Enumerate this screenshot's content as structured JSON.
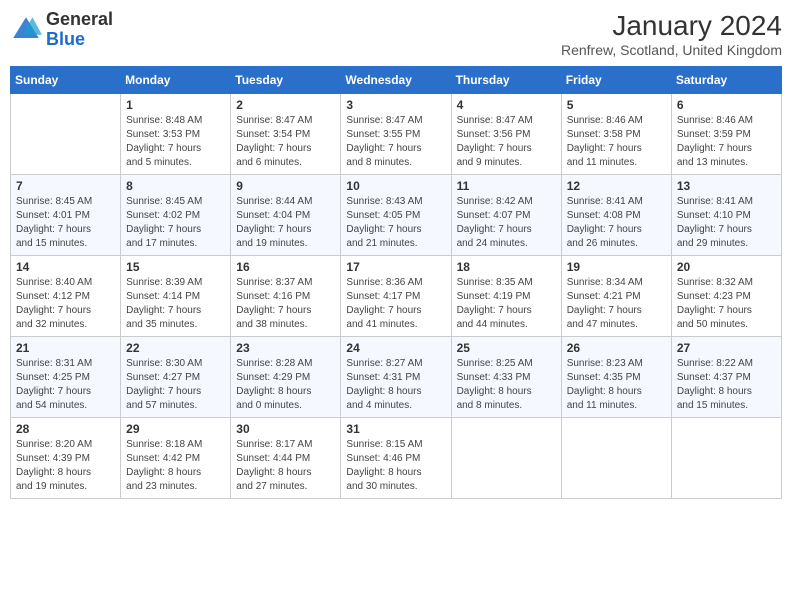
{
  "header": {
    "logo_line1": "General",
    "logo_line2": "Blue",
    "title": "January 2024",
    "location": "Renfrew, Scotland, United Kingdom"
  },
  "columns": [
    "Sunday",
    "Monday",
    "Tuesday",
    "Wednesday",
    "Thursday",
    "Friday",
    "Saturday"
  ],
  "weeks": [
    [
      {
        "day": "",
        "info": ""
      },
      {
        "day": "1",
        "info": "Sunrise: 8:48 AM\nSunset: 3:53 PM\nDaylight: 7 hours\nand 5 minutes."
      },
      {
        "day": "2",
        "info": "Sunrise: 8:47 AM\nSunset: 3:54 PM\nDaylight: 7 hours\nand 6 minutes."
      },
      {
        "day": "3",
        "info": "Sunrise: 8:47 AM\nSunset: 3:55 PM\nDaylight: 7 hours\nand 8 minutes."
      },
      {
        "day": "4",
        "info": "Sunrise: 8:47 AM\nSunset: 3:56 PM\nDaylight: 7 hours\nand 9 minutes."
      },
      {
        "day": "5",
        "info": "Sunrise: 8:46 AM\nSunset: 3:58 PM\nDaylight: 7 hours\nand 11 minutes."
      },
      {
        "day": "6",
        "info": "Sunrise: 8:46 AM\nSunset: 3:59 PM\nDaylight: 7 hours\nand 13 minutes."
      }
    ],
    [
      {
        "day": "7",
        "info": "Sunrise: 8:45 AM\nSunset: 4:01 PM\nDaylight: 7 hours\nand 15 minutes."
      },
      {
        "day": "8",
        "info": "Sunrise: 8:45 AM\nSunset: 4:02 PM\nDaylight: 7 hours\nand 17 minutes."
      },
      {
        "day": "9",
        "info": "Sunrise: 8:44 AM\nSunset: 4:04 PM\nDaylight: 7 hours\nand 19 minutes."
      },
      {
        "day": "10",
        "info": "Sunrise: 8:43 AM\nSunset: 4:05 PM\nDaylight: 7 hours\nand 21 minutes."
      },
      {
        "day": "11",
        "info": "Sunrise: 8:42 AM\nSunset: 4:07 PM\nDaylight: 7 hours\nand 24 minutes."
      },
      {
        "day": "12",
        "info": "Sunrise: 8:41 AM\nSunset: 4:08 PM\nDaylight: 7 hours\nand 26 minutes."
      },
      {
        "day": "13",
        "info": "Sunrise: 8:41 AM\nSunset: 4:10 PM\nDaylight: 7 hours\nand 29 minutes."
      }
    ],
    [
      {
        "day": "14",
        "info": "Sunrise: 8:40 AM\nSunset: 4:12 PM\nDaylight: 7 hours\nand 32 minutes."
      },
      {
        "day": "15",
        "info": "Sunrise: 8:39 AM\nSunset: 4:14 PM\nDaylight: 7 hours\nand 35 minutes."
      },
      {
        "day": "16",
        "info": "Sunrise: 8:37 AM\nSunset: 4:16 PM\nDaylight: 7 hours\nand 38 minutes."
      },
      {
        "day": "17",
        "info": "Sunrise: 8:36 AM\nSunset: 4:17 PM\nDaylight: 7 hours\nand 41 minutes."
      },
      {
        "day": "18",
        "info": "Sunrise: 8:35 AM\nSunset: 4:19 PM\nDaylight: 7 hours\nand 44 minutes."
      },
      {
        "day": "19",
        "info": "Sunrise: 8:34 AM\nSunset: 4:21 PM\nDaylight: 7 hours\nand 47 minutes."
      },
      {
        "day": "20",
        "info": "Sunrise: 8:32 AM\nSunset: 4:23 PM\nDaylight: 7 hours\nand 50 minutes."
      }
    ],
    [
      {
        "day": "21",
        "info": "Sunrise: 8:31 AM\nSunset: 4:25 PM\nDaylight: 7 hours\nand 54 minutes."
      },
      {
        "day": "22",
        "info": "Sunrise: 8:30 AM\nSunset: 4:27 PM\nDaylight: 7 hours\nand 57 minutes."
      },
      {
        "day": "23",
        "info": "Sunrise: 8:28 AM\nSunset: 4:29 PM\nDaylight: 8 hours\nand 0 minutes."
      },
      {
        "day": "24",
        "info": "Sunrise: 8:27 AM\nSunset: 4:31 PM\nDaylight: 8 hours\nand 4 minutes."
      },
      {
        "day": "25",
        "info": "Sunrise: 8:25 AM\nSunset: 4:33 PM\nDaylight: 8 hours\nand 8 minutes."
      },
      {
        "day": "26",
        "info": "Sunrise: 8:23 AM\nSunset: 4:35 PM\nDaylight: 8 hours\nand 11 minutes."
      },
      {
        "day": "27",
        "info": "Sunrise: 8:22 AM\nSunset: 4:37 PM\nDaylight: 8 hours\nand 15 minutes."
      }
    ],
    [
      {
        "day": "28",
        "info": "Sunrise: 8:20 AM\nSunset: 4:39 PM\nDaylight: 8 hours\nand 19 minutes."
      },
      {
        "day": "29",
        "info": "Sunrise: 8:18 AM\nSunset: 4:42 PM\nDaylight: 8 hours\nand 23 minutes."
      },
      {
        "day": "30",
        "info": "Sunrise: 8:17 AM\nSunset: 4:44 PM\nDaylight: 8 hours\nand 27 minutes."
      },
      {
        "day": "31",
        "info": "Sunrise: 8:15 AM\nSunset: 4:46 PM\nDaylight: 8 hours\nand 30 minutes."
      },
      {
        "day": "",
        "info": ""
      },
      {
        "day": "",
        "info": ""
      },
      {
        "day": "",
        "info": ""
      }
    ]
  ]
}
